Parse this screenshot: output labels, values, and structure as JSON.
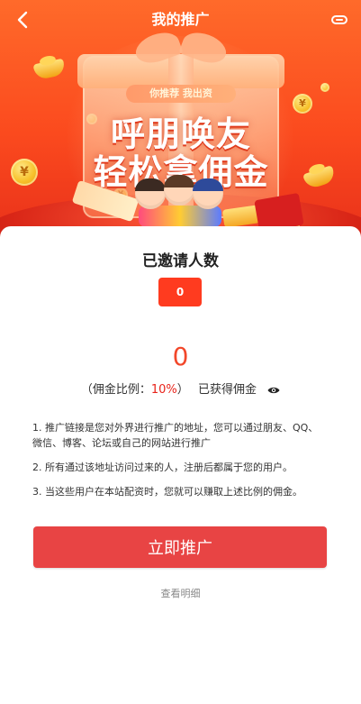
{
  "header": {
    "title": "我的推广",
    "back_icon": "chevron-left-icon",
    "share_icon": "share-link-icon"
  },
  "banner": {
    "slogan": "你推荐 我出资",
    "headline_line1": "呼朋唤友",
    "headline_line2": "轻松拿佣金",
    "coin_symbol": "¥"
  },
  "stats": {
    "invited_label": "已邀请人数",
    "invited_count": "0",
    "earned_amount": "0",
    "rate_prefix": "（佣金比例：",
    "rate_value": "10%",
    "rate_suffix": "）",
    "earned_label": "已获得佣金"
  },
  "rules": [
    "1. 推广链接是您对外界进行推广的地址，您可以通过朋友、QQ、 微信、博客、论坛或自己的网站进行推广",
    "2. 所有通过该地址访问过来的人，注册后都属于您的用户。",
    "3. 当这些用户在本站配资时，您就可以赚取上述比例的佣金。"
  ],
  "actions": {
    "promote_label": "立即推广",
    "details_label": "查看明细"
  },
  "colors": {
    "banner_primary": "#fb4a1e",
    "accent_red": "#e84444",
    "count_badge": "#ff3b1f",
    "amount_text": "#f2472a",
    "rate_text": "#e8231a"
  }
}
